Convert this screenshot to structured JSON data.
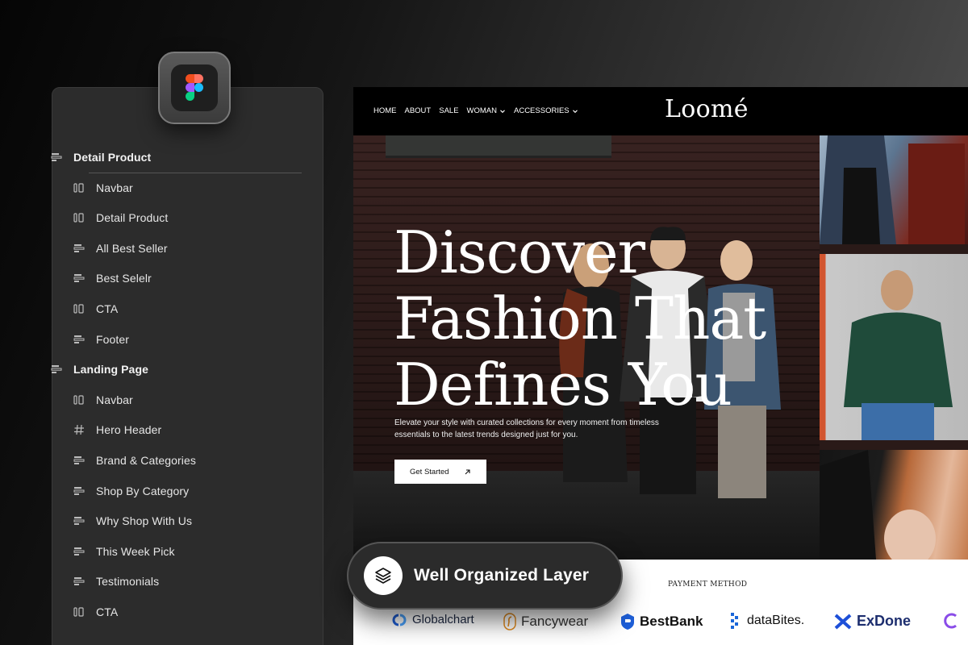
{
  "layers": {
    "groups": [
      {
        "label": "Detail Product",
        "icon": "frame-icon",
        "children": [
          {
            "label": "Navbar",
            "icon": "component-icon"
          },
          {
            "label": "Detail Product",
            "icon": "component-icon"
          },
          {
            "label": "All Best Seller",
            "icon": "frame-icon"
          },
          {
            "label": "Best Selelr",
            "icon": "frame-icon"
          },
          {
            "label": "CTA",
            "icon": "component-icon"
          },
          {
            "label": "Footer",
            "icon": "frame-icon"
          }
        ]
      },
      {
        "label": "Landing Page",
        "icon": "frame-icon",
        "children": [
          {
            "label": "Navbar",
            "icon": "component-icon"
          },
          {
            "label": "Hero Header",
            "icon": "hash-icon"
          },
          {
            "label": "Brand & Categories",
            "icon": "frame-icon"
          },
          {
            "label": "Shop By Category",
            "icon": "frame-icon"
          },
          {
            "label": "Why Shop With Us",
            "icon": "frame-icon"
          },
          {
            "label": "This Week Pick",
            "icon": "frame-icon"
          },
          {
            "label": "Testimonials",
            "icon": "frame-icon"
          },
          {
            "label": "CTA",
            "icon": "component-icon"
          }
        ]
      }
    ]
  },
  "site": {
    "nav": {
      "links": [
        "HOME",
        "ABOUT",
        "SALE",
        "WOMAN",
        "ACCESSORIES"
      ],
      "dropdown_links": [
        "WOMAN",
        "ACCESSORIES"
      ]
    },
    "logo": "Loomé",
    "hero": {
      "title_lines": [
        "Discover",
        "Fashion That",
        "Defines You"
      ],
      "subtitle": "Elevate your style with curated collections for every moment from timeless essentials to the latest trends designed just for you.",
      "cta_label": "Get Started"
    },
    "payment": {
      "title": "PAYMENT METHOD",
      "brands": [
        "Globalchart",
        "Fancywear",
        "BestBank",
        "dataBites.",
        "ExDone"
      ]
    }
  },
  "badge": {
    "label": "Well Organized Layer",
    "icon": "layers-icon"
  },
  "colors": {
    "panel_bg": "#2c2c2c",
    "site_bg": "#000000",
    "globalchart": "#1f5fd6",
    "fancywear": "#e08a1e",
    "bestbank": "#1e5fd8",
    "databites": "#1a66d9",
    "exdone": "#1d4fd8"
  }
}
